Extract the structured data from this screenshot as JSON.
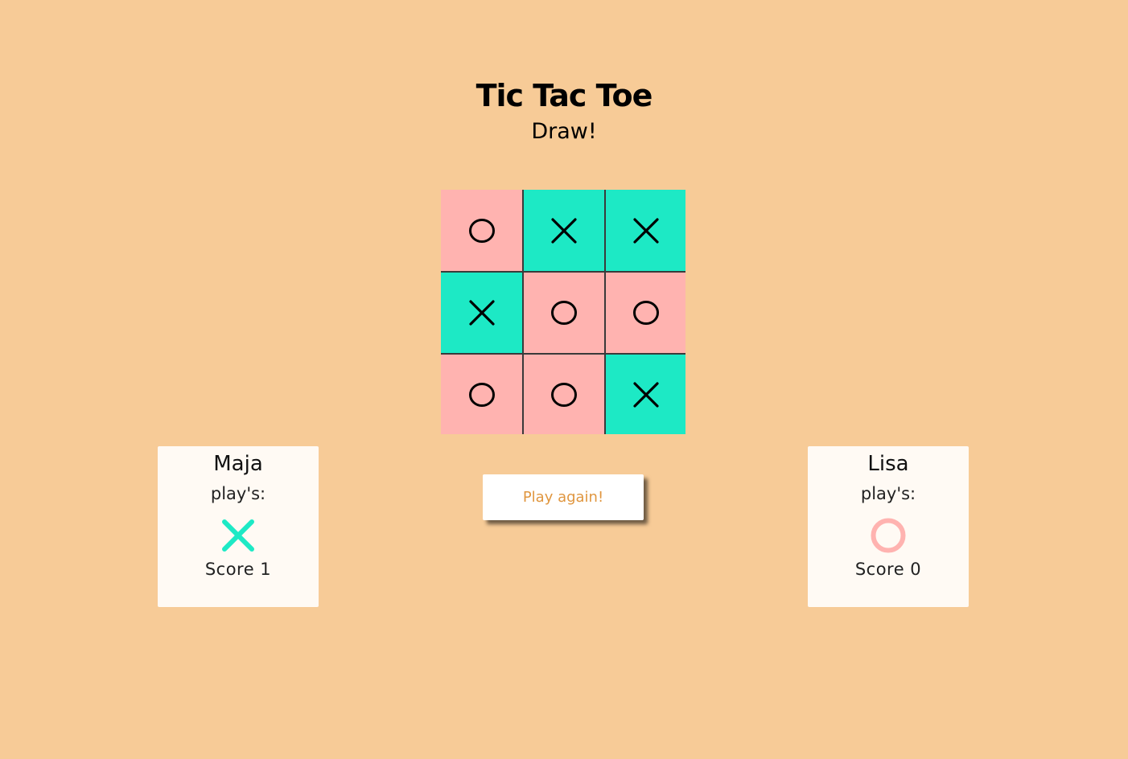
{
  "header": {
    "title": "Tic Tac Toe",
    "status": "Draw!"
  },
  "board": {
    "cells": [
      "O",
      "X",
      "X",
      "X",
      "O",
      "O",
      "O",
      "O",
      "X"
    ]
  },
  "players": [
    {
      "name": "Maja",
      "plays_label": "play's:",
      "mark": "X",
      "score_label": "Score 1"
    },
    {
      "name": "Lisa",
      "plays_label": "play's:",
      "mark": "O",
      "score_label": "Score 0"
    }
  ],
  "actions": {
    "play_again_label": "Play again!"
  },
  "colors": {
    "background": "#f7cb97",
    "x_cell": "#1de9c5",
    "o_cell": "#ffb3b0",
    "button_text": "#e0963f"
  }
}
